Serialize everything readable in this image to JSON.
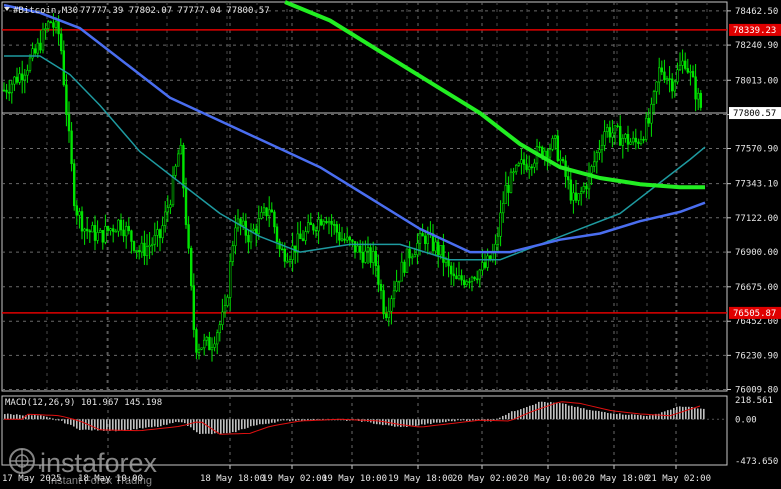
{
  "chart_header": {
    "symbol": "#Bitcoin,M30",
    "ohlc": "77777.39 77802.07 77777.04 77800.57"
  },
  "macd_header": {
    "label": "MACD(12,26,9) 101.967 145.198"
  },
  "watermark": {
    "brand": "instaforex",
    "tagline": "Instant Forex Trading"
  },
  "colors": {
    "candle": "#00e600",
    "ma_fast": "#1e9aa0",
    "ma_mid": "#4a6ef0",
    "ma_slow": "#22ee22",
    "level_line": "#e00000",
    "histogram": "#c0c0c0",
    "signal": "#e01010"
  },
  "chart_data": {
    "type": "candlestick",
    "price_axis": [
      "78462.50",
      "78240.90",
      "78013.00",
      "77790.90",
      "77570.90",
      "77343.10",
      "77122.00",
      "76900.00",
      "76675.00",
      "76452.00",
      "76230.90",
      "76009.80"
    ],
    "ylim": [
      76000,
      78520
    ],
    "time_axis": [
      "17 May 2025",
      "18 May 10:00",
      "18 May 18:00",
      "19 May 02:00",
      "19 May 10:00",
      "19 May 18:00",
      "20 May 02:00",
      "20 May 10:00",
      "20 May 18:00",
      "21 May 02:00"
    ],
    "levels": [
      {
        "name": "resistance",
        "value": 78339.23,
        "label": "78339.23"
      },
      {
        "name": "support",
        "value": 76505.87,
        "label": "76505.87"
      },
      {
        "name": "current",
        "value": 77800.57,
        "label": "77800.57"
      }
    ],
    "macd_axis": [
      "218.561",
      "0.00",
      "-473.650"
    ],
    "macd_ylim": [
      -473.65,
      218.561
    ],
    "macd_current": {
      "macd": 101.967,
      "signal": 145.198
    }
  }
}
